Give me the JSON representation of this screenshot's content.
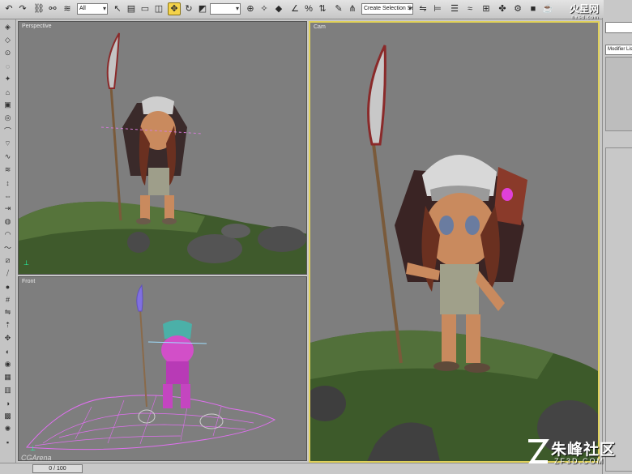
{
  "toolbar": {
    "filter": "All",
    "named_selection": "Create Selection Set",
    "icons": [
      "undo-icon",
      "redo-icon",
      "select-link-icon",
      "unlink-icon",
      "bind-space-warp-icon",
      "selection-filter-dropdown",
      "select-object-icon",
      "select-by-name-icon",
      "rect-selection-region-icon",
      "window-crossing-icon",
      "select-and-move-icon",
      "select-and-rotate-icon",
      "select-and-scale-icon",
      "reference-coordinate-dropdown",
      "use-pivot-center-icon",
      "select-and-manipulate-icon",
      "snaps-toggle-icon",
      "angle-snap-icon",
      "percent-snap-icon",
      "spinner-snap-icon",
      "edit-named-selection-icon",
      "named-selection-sets-dropdown",
      "mirror-icon",
      "align-icon",
      "layer-manager-icon",
      "curve-editor-icon",
      "schematic-view-icon",
      "material-editor-icon",
      "render-setup-icon",
      "rendered-frame-icon",
      "quick-render-icon"
    ]
  },
  "viewports": {
    "perspective": "Perspective",
    "front": "Front",
    "camera": "Cam"
  },
  "command_panel": {
    "modifier_list": "Modifier List"
  },
  "status": {
    "frame": "0 / 100"
  },
  "watermarks": {
    "top_right": "火星网",
    "top_right_sub": "hxsd.com",
    "bottom_right": "朱峰社区",
    "bottom_right_sub": "ZF3D.COM",
    "bottom_left": "CGArena"
  },
  "colors": {
    "active_viewport_border": "#e0d15a",
    "active_tool": "#f4d34a",
    "viewport_bg": "#7e7e7e",
    "wireframe": "#e070f0"
  }
}
